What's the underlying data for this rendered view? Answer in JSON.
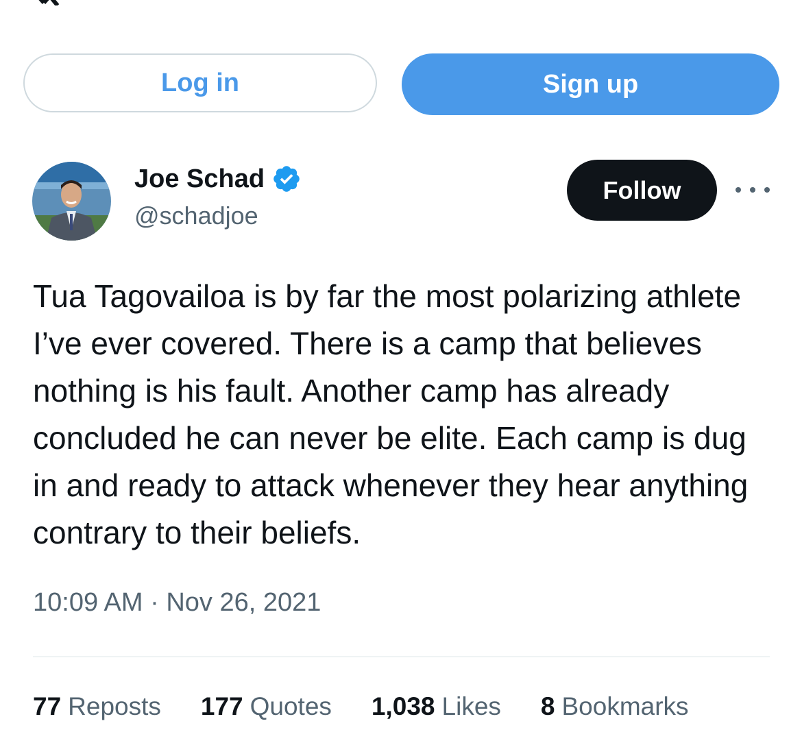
{
  "auth": {
    "login_label": "Log in",
    "signup_label": "Sign up"
  },
  "author": {
    "display_name": "Joe Schad",
    "handle": "@schadjoe",
    "verified": true,
    "avatar_icon": "profile-photo"
  },
  "actions": {
    "follow_label": "Follow",
    "more_icon": "more-horizontal-icon"
  },
  "tweet": {
    "text": "Tua Tagovailoa is by far the most polarizing athlete I’ve ever covered. There is a camp that believes nothing is his fault. Another camp has already concluded he can never be elite. Each camp is dug in and ready to attack whenever they hear anything contrary to their beliefs.",
    "timestamp": "10:09 AM · Nov 26, 2021"
  },
  "stats": [
    {
      "count": "77",
      "label": "Reposts"
    },
    {
      "count": "177",
      "label": "Quotes"
    },
    {
      "count": "1,038",
      "label": "Likes"
    },
    {
      "count": "8",
      "label": "Bookmarks"
    }
  ],
  "colors": {
    "accent": "#4a99e9",
    "text": "#0f1419",
    "muted": "#536471",
    "follow_bg": "#0f1419"
  }
}
